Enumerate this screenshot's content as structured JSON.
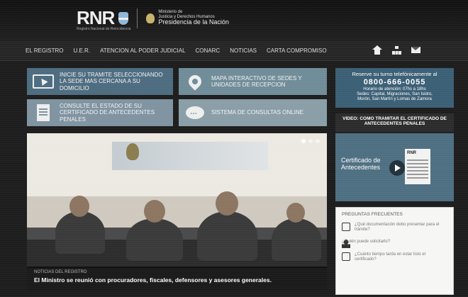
{
  "header": {
    "logo_text": "RNR",
    "logo_sub": "Registro Nacional de Reincidencia",
    "ministry_line1": "Ministerio de",
    "ministry_line2": "Justicia y Derechos Humanos",
    "presidency": "Presidencia de la Nación"
  },
  "nav": {
    "items": [
      "EL REGISTRO",
      "U.E.R.",
      "ATENCION AL PODER JUDICIAL",
      "CONARC",
      "NOTICIAS",
      "CARTA COMPROMISO"
    ],
    "icons": [
      "home-icon",
      "sitemap-icon",
      "mail-icon"
    ]
  },
  "tiles": [
    {
      "text": "INICIE SU TRAMITE SELECCIONANDO LA SEDE MAS CERCANA A SU DOMICILIO",
      "icon": "cursor-icon",
      "color": "#4d6c80"
    },
    {
      "text": "MAPA INTERACTIVO DE SEDES Y UNIDADES DE RECEPCION",
      "icon": "map-pin-icon",
      "color": "#6f8c98"
    },
    {
      "text": "CONSULTE EL ESTADO DE SU CERTIFICADO DE ANTECEDENTES PENALES",
      "icon": "document-icon",
      "color": "#7f93a0"
    },
    {
      "text": "SISTEMA DE CONSULTAS ONLINE",
      "icon": "chat-icon",
      "color": "#8a9ea8"
    }
  ],
  "slider": {
    "date": "NOTICIAS DEL REGISTRO",
    "caption": "El Ministro se reunió con procuradores, fiscales, defensores y asesores generales.",
    "dots": 3
  },
  "phone": {
    "line1": "Reserve su turno telefónicamente al",
    "number": "0800-666-0055",
    "line2": "Horario de atención: 07hs a 18hs",
    "line3": "Sedes: Capital, Migraciones, San Isidro,",
    "line4": "Morón, San Martín y Lomas de Zamora"
  },
  "video": {
    "title": "VIDEO: COMO TRAMITAR EL CERTIFICADO DE ANTECEDENTES PENALES",
    "cert_line1": "Certificado de",
    "cert_line2": "Antecedentes",
    "doc_label": "RNR"
  },
  "faq": {
    "title": "PREGUNTAS FRECUENTES",
    "items": [
      {
        "text": "¿Qué documentación debo presentar para el trámite?",
        "icon": "question-icon"
      },
      {
        "text": "¿Quién puede solicitarlo?",
        "icon": "person-icon"
      },
      {
        "text": "¿Cuánto tiempo tarda en estar listo el certificado?",
        "icon": "clock-icon"
      }
    ]
  }
}
